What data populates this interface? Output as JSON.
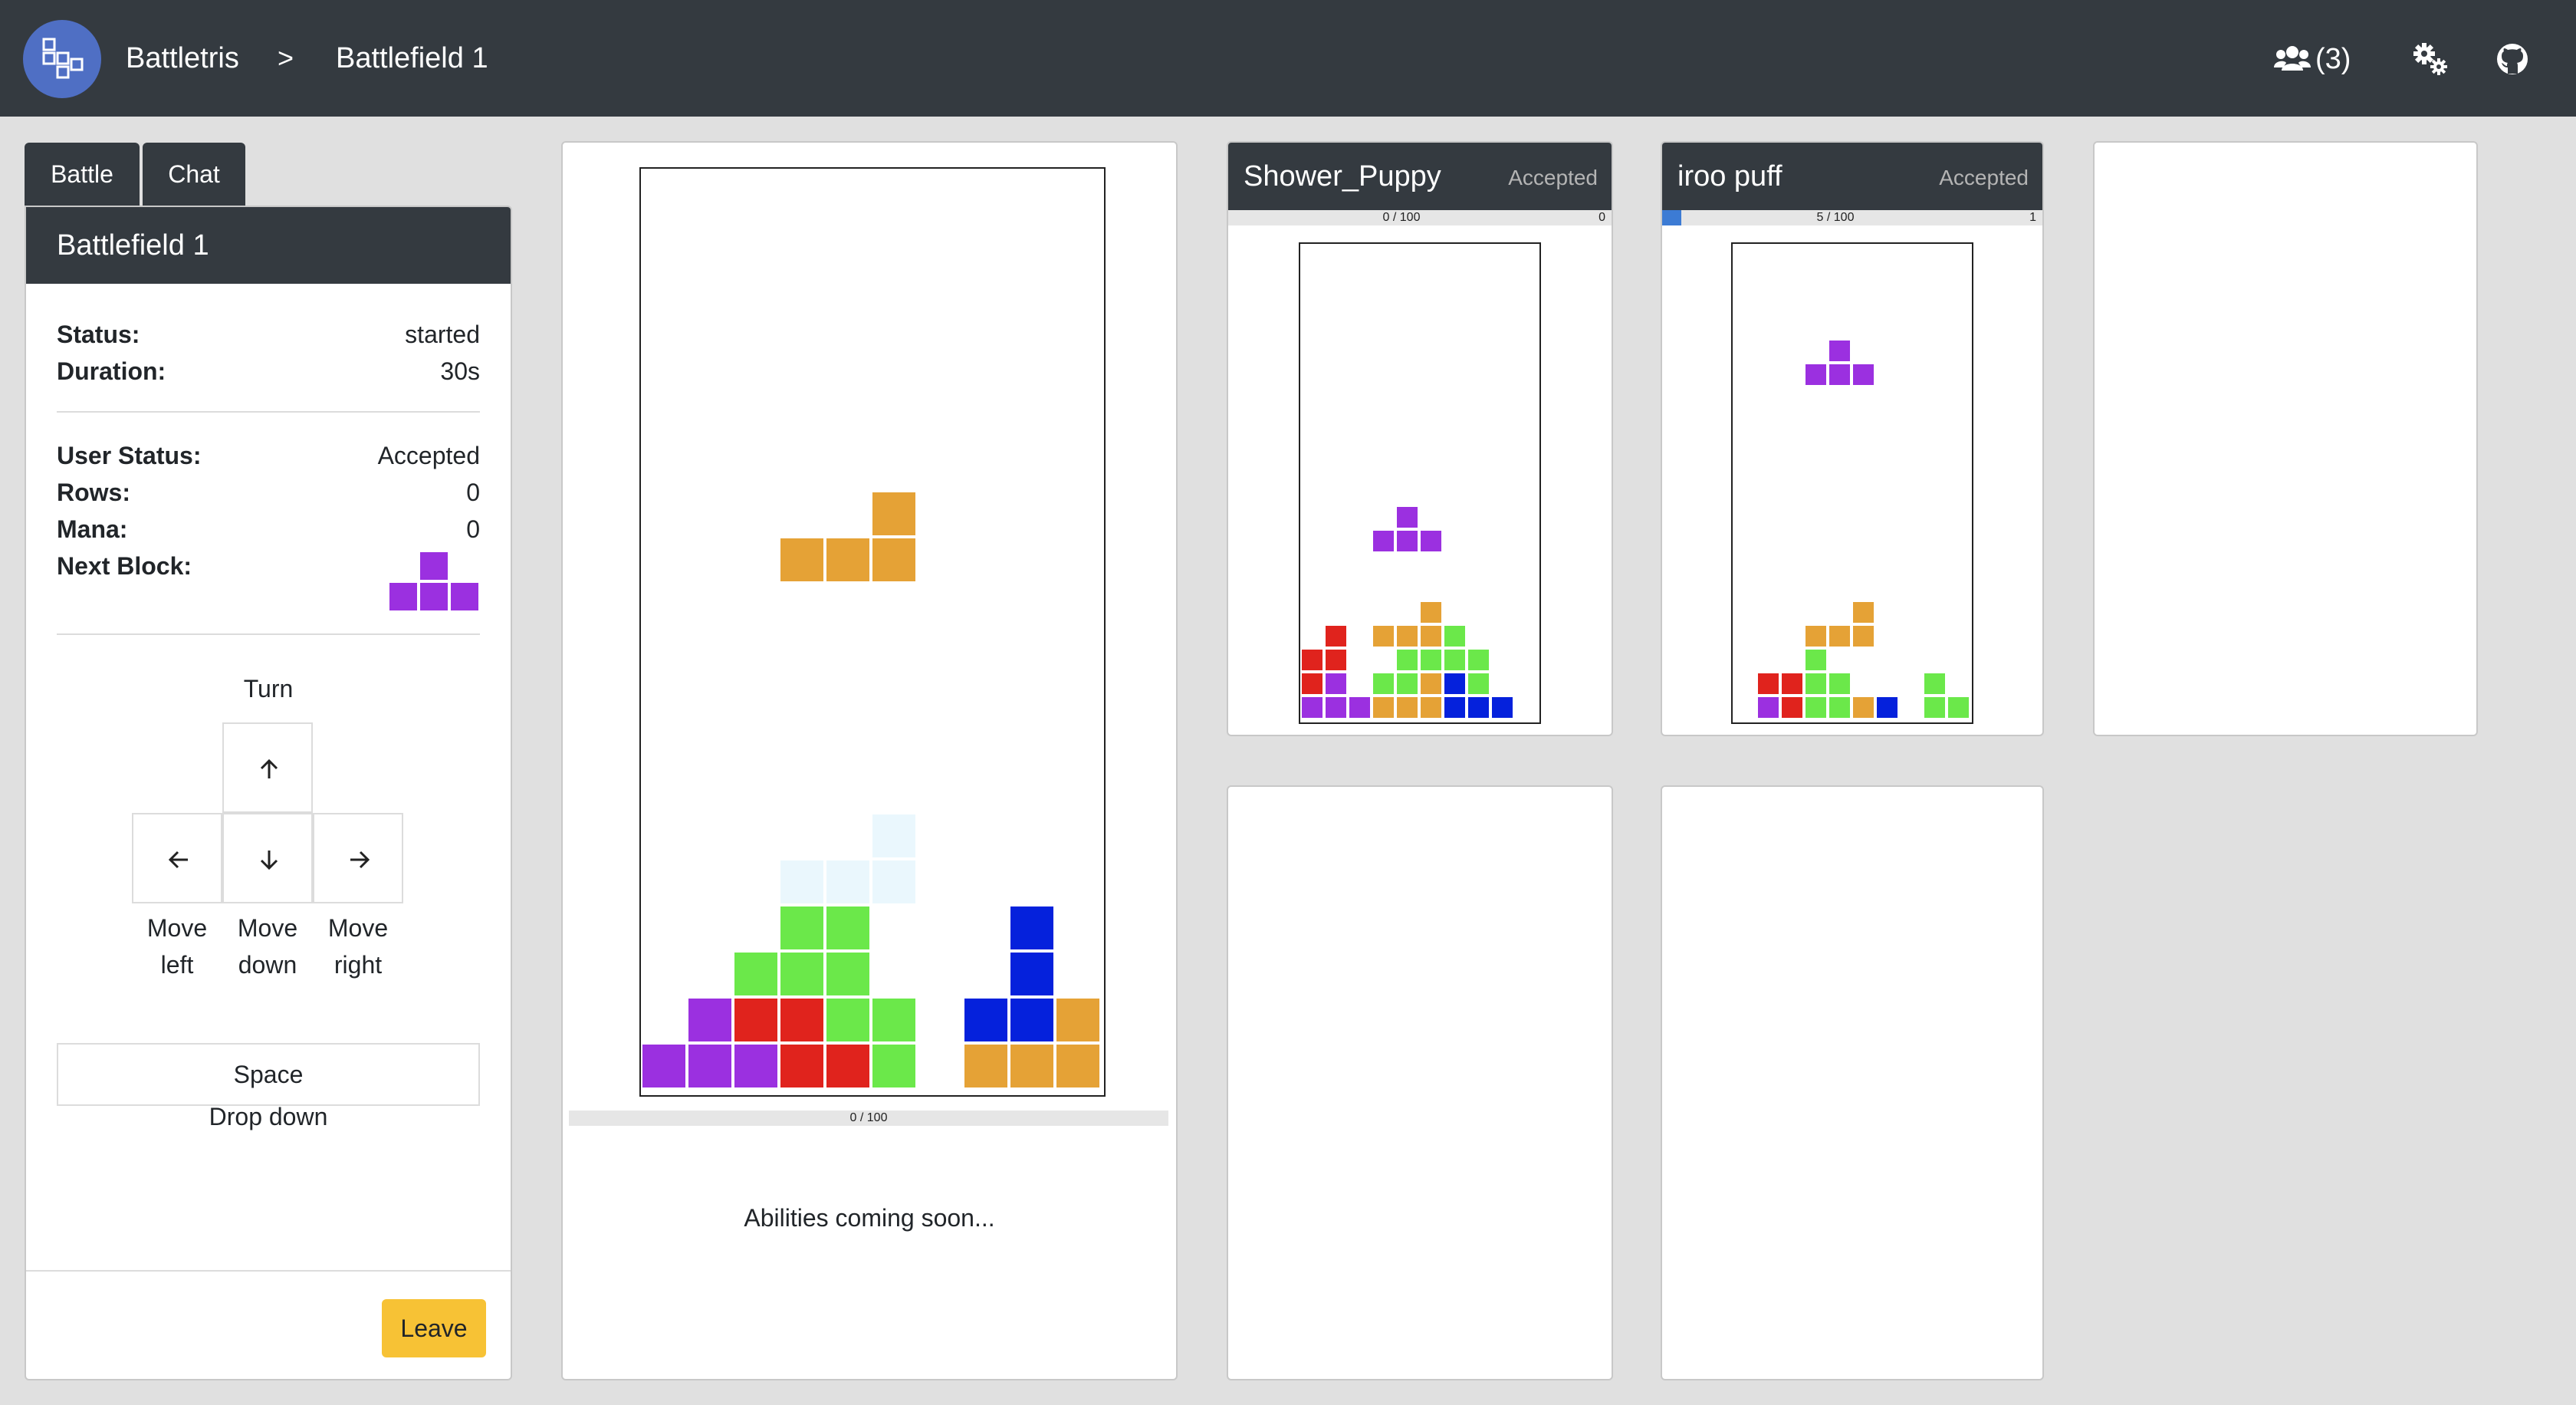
{
  "navbar": {
    "brand": "Battletris",
    "breadcrumb_separator": ">",
    "breadcrumb_page": "Battlefield 1",
    "user_count": "(3)",
    "icons": [
      "users-icon",
      "gear-icon",
      "github-icon"
    ]
  },
  "tabs": [
    {
      "label": "Battle",
      "active": true
    },
    {
      "label": "Chat",
      "active": false
    }
  ],
  "info": {
    "title": "Battlefield 1",
    "status_label": "Status:",
    "status_value": "started",
    "duration_label": "Duration:",
    "duration_value": "30s",
    "user_status_label": "User Status:",
    "user_status_value": "Accepted",
    "rows_label": "Rows:",
    "rows_value": "0",
    "mana_label": "Mana:",
    "mana_value": "0",
    "next_block_label": "Next Block:",
    "next_block_color": "#9b30e0"
  },
  "controls": {
    "turn_label": "Turn",
    "move_left_label": "Move left",
    "move_down_label": "Move down",
    "move_right_label": "Move right",
    "space_label": "Space",
    "drop_label": "Drop down",
    "leave_label": "Leave"
  },
  "colors": {
    "purple": "#9b30e0",
    "red": "#e0231d",
    "green": "#6be84a",
    "orange": "#e5a236",
    "blue": "#0521dc",
    "ghost": "#eaf7fd",
    "navbar": "#343a40",
    "leave": "#f7c235"
  },
  "main": {
    "progress_text": "0 / 100",
    "abilities_text": "Abilities coming soon...",
    "cols": 10,
    "rows": 20,
    "active_piece": {
      "color": "orange",
      "cells": [
        [
          5,
          7
        ],
        [
          3,
          8
        ],
        [
          4,
          8
        ],
        [
          5,
          8
        ]
      ]
    },
    "ghost_piece": {
      "color": "ghost",
      "cells": [
        [
          5,
          14
        ],
        [
          3,
          15
        ],
        [
          4,
          15
        ],
        [
          5,
          15
        ]
      ]
    },
    "stack": [
      {
        "color": "green",
        "cells": [
          [
            3,
            16
          ],
          [
            4,
            16
          ],
          [
            2,
            17
          ],
          [
            3,
            17
          ],
          [
            4,
            17
          ],
          [
            4,
            18
          ],
          [
            5,
            18
          ],
          [
            5,
            19
          ]
        ]
      },
      {
        "color": "purple",
        "cells": [
          [
            1,
            18
          ],
          [
            0,
            19
          ],
          [
            1,
            19
          ],
          [
            2,
            19
          ]
        ]
      },
      {
        "color": "red",
        "cells": [
          [
            2,
            18
          ],
          [
            3,
            18
          ],
          [
            3,
            19
          ],
          [
            4,
            19
          ]
        ]
      },
      {
        "color": "blue",
        "cells": [
          [
            8,
            16
          ],
          [
            8,
            17
          ],
          [
            7,
            18
          ],
          [
            8,
            18
          ]
        ]
      },
      {
        "color": "orange",
        "cells": [
          [
            9,
            18
          ],
          [
            7,
            19
          ],
          [
            8,
            19
          ],
          [
            9,
            19
          ]
        ]
      }
    ]
  },
  "opponents": [
    {
      "name": "Shower_Puppy",
      "status": "Accepted",
      "progress_text": "0 / 100",
      "progress": 0,
      "rows": "0",
      "pieces": [
        {
          "color": "purple",
          "cells": [
            [
              4,
              11
            ],
            [
              3,
              12
            ],
            [
              4,
              12
            ],
            [
              5,
              12
            ]
          ]
        },
        {
          "color": "orange",
          "cells": [
            [
              5,
              15
            ],
            [
              3,
              16
            ],
            [
              4,
              16
            ],
            [
              5,
              16
            ],
            [
              3,
              19
            ],
            [
              4,
              19
            ],
            [
              5,
              19
            ]
          ]
        },
        {
          "color": "green",
          "cells": [
            [
              6,
              16
            ],
            [
              4,
              17
            ],
            [
              5,
              17
            ],
            [
              6,
              17
            ],
            [
              7,
              17
            ],
            [
              3,
              18
            ],
            [
              4,
              18
            ],
            [
              7,
              18
            ]
          ]
        },
        {
          "color": "orange",
          "cells": [
            [
              5,
              18
            ]
          ]
        },
        {
          "color": "blue",
          "cells": [
            [
              6,
              18
            ],
            [
              6,
              19
            ],
            [
              7,
              19
            ],
            [
              8,
              19
            ]
          ]
        },
        {
          "color": "red",
          "cells": [
            [
              1,
              16
            ],
            [
              0,
              17
            ],
            [
              1,
              17
            ],
            [
              0,
              18
            ]
          ]
        },
        {
          "color": "purple",
          "cells": [
            [
              1,
              18
            ],
            [
              0,
              19
            ],
            [
              1,
              19
            ],
            [
              2,
              19
            ]
          ]
        }
      ]
    },
    {
      "name": "iroo puff",
      "status": "Accepted",
      "progress_text": "5 / 100",
      "progress": 0.05,
      "rows": "1",
      "pieces": [
        {
          "color": "purple",
          "cells": [
            [
              4,
              4
            ],
            [
              3,
              5
            ],
            [
              4,
              5
            ],
            [
              5,
              5
            ]
          ]
        },
        {
          "color": "orange",
          "cells": [
            [
              5,
              15
            ],
            [
              3,
              16
            ],
            [
              4,
              16
            ],
            [
              5,
              16
            ],
            [
              5,
              19
            ]
          ]
        },
        {
          "color": "green",
          "cells": [
            [
              3,
              17
            ],
            [
              3,
              18
            ],
            [
              4,
              18
            ],
            [
              8,
              18
            ],
            [
              3,
              19
            ],
            [
              4,
              19
            ],
            [
              8,
              19
            ],
            [
              9,
              19
            ]
          ]
        },
        {
          "color": "red",
          "cells": [
            [
              1,
              18
            ],
            [
              2,
              18
            ],
            [
              1,
              19
            ],
            [
              2,
              19
            ]
          ]
        },
        {
          "color": "purple",
          "cells": [
            [
              1,
              19
            ]
          ]
        },
        {
          "color": "blue",
          "cells": [
            [
              6,
              19
            ]
          ]
        }
      ]
    }
  ]
}
